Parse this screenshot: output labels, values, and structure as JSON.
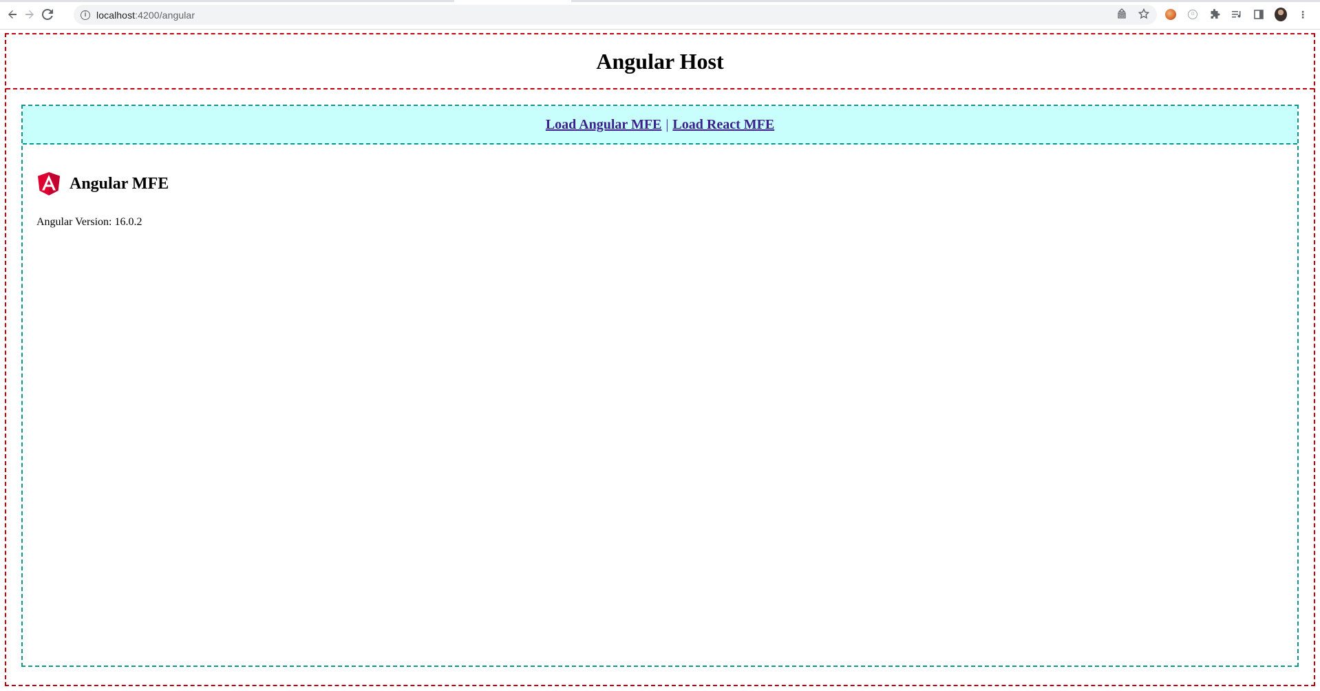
{
  "browser": {
    "url_host": "localhost",
    "url_path": ":4200/angular",
    "icons": {
      "back": "arrow-left-icon",
      "forward": "arrow-right-icon",
      "reload": "reload-icon",
      "site_info": "info-icon",
      "share": "share-icon",
      "bookmark": "star-icon",
      "extensions": "puzzle-icon",
      "reading_list": "reading-list-icon",
      "side_panel": "side-panel-icon",
      "menu": "kebab-menu-icon"
    }
  },
  "host": {
    "title": "Angular Host",
    "border_color": "#c0000c"
  },
  "nav": {
    "angular_link": "Load Angular MFE",
    "separator": "|",
    "react_link": "Load React MFE",
    "background": "#c8fffd",
    "border_color": "#0e968e",
    "link_color": "#3b1f8f"
  },
  "mfe": {
    "title": "Angular MFE",
    "logo": "angular-logo-icon",
    "logo_color": "#dd0031",
    "version_label": "Angular Version: 16.0.2"
  }
}
